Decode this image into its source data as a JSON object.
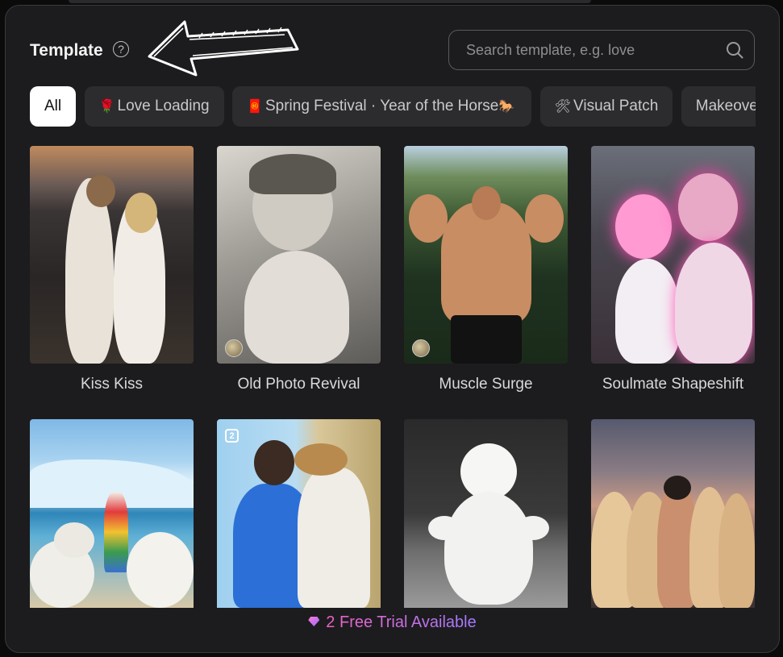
{
  "header": {
    "title": "Template",
    "help_glyph": "?"
  },
  "search": {
    "placeholder": "Search template, e.g. love",
    "value": ""
  },
  "categories": [
    {
      "label": "All",
      "emoji": "",
      "emoji_after": "",
      "active": true
    },
    {
      "label": "Love Loading",
      "emoji": "🌹",
      "emoji_after": "",
      "active": false
    },
    {
      "label": "Spring Festival · Year of the Horse",
      "emoji": "🧧",
      "emoji_after": "🐎",
      "active": false
    },
    {
      "label": "Visual Patch",
      "emoji": "🛠",
      "emoji_after": "",
      "active": false
    },
    {
      "label": "Makeover Stud",
      "emoji": "",
      "emoji_after": "",
      "active": false
    }
  ],
  "templates": [
    {
      "label": "Kiss Kiss",
      "theme": "sunset-couple"
    },
    {
      "label": "Old Photo Revival",
      "theme": "vintage-child"
    },
    {
      "label": "Muscle Surge",
      "theme": "muscle-man"
    },
    {
      "label": "Soulmate Shapeshift",
      "theme": "pink-glow-couple"
    },
    {
      "label": "",
      "theme": "polar-bears"
    },
    {
      "label": "",
      "theme": "hug-couple",
      "multi_count": "2"
    },
    {
      "label": "",
      "theme": "white-dog"
    },
    {
      "label": "",
      "theme": "group-girls"
    }
  ],
  "footer": {
    "trial_text": "2 Free Trial Available"
  },
  "colors": {
    "panel": "#1c1c1e",
    "chip": "#2c2c2f",
    "chip_active": "#ffffff",
    "trial_gradient": [
      "#f062c0",
      "#a37bff"
    ]
  }
}
